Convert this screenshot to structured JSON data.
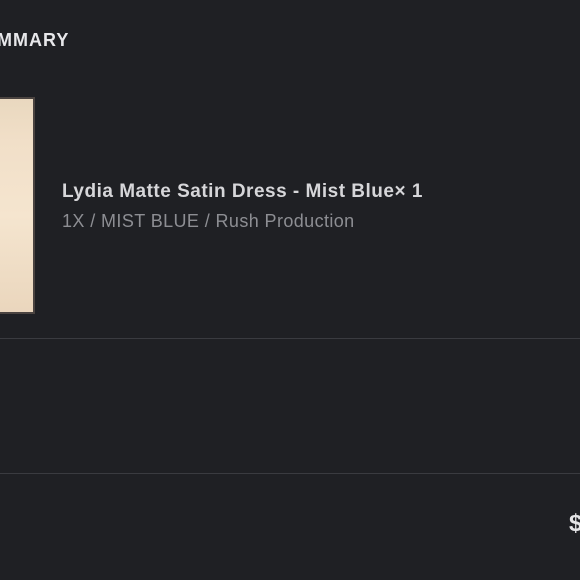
{
  "order_summary": {
    "title": "MMARY",
    "item": {
      "name": "Lydia Matte Satin Dress - Mist Blue",
      "quantity_text": "× 1",
      "variant": "1X / MIST BLUE / Rush Production"
    },
    "total_price_partial": "$"
  },
  "colors": {
    "background": "#1f2024",
    "text_primary": "#d6d6d9",
    "text_secondary": "#8d8e93",
    "divider": "#3a3b40"
  }
}
